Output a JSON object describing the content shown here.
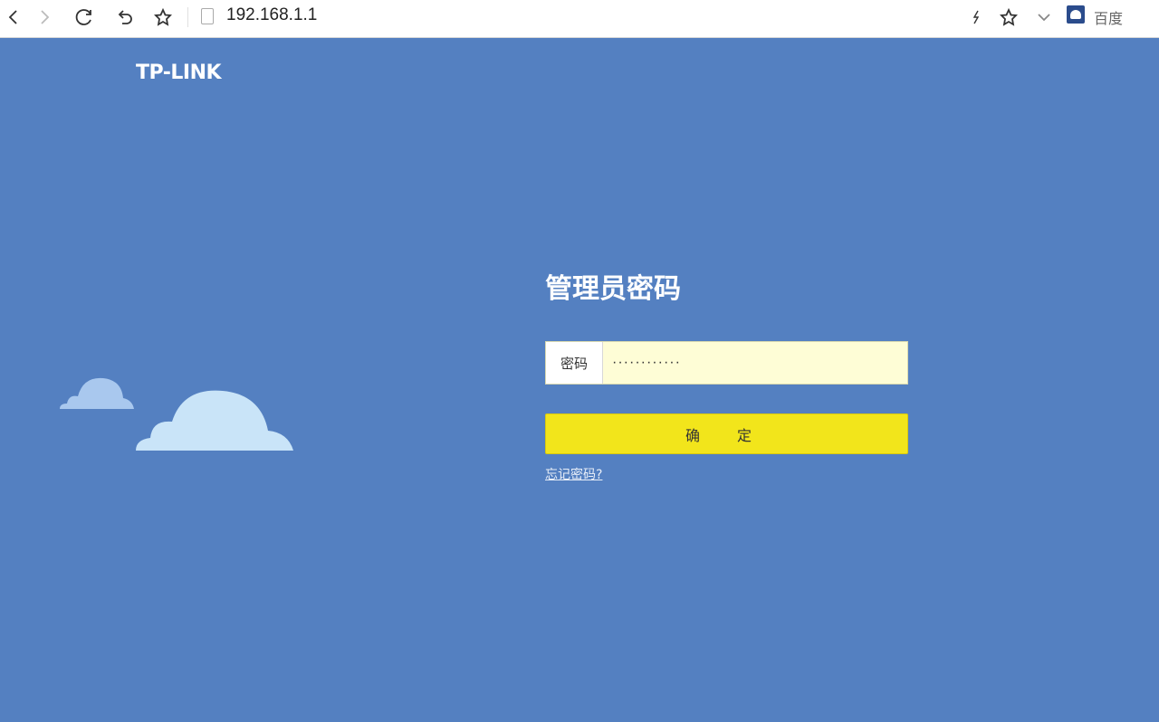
{
  "browser": {
    "url": "192.168.1.1",
    "search_engine": "百度"
  },
  "page": {
    "logo": "TP-LINK",
    "title": "管理员密码",
    "password_label": "密码",
    "password_value": "············",
    "confirm_label": "确 定",
    "forgot_link": "忘记密码?"
  },
  "colors": {
    "background": "#5480c1",
    "button": "#f2e51b",
    "input_bg": "#fefdd6",
    "cloud_small": "#a9c8ee",
    "cloud_large": "#c9e4f8"
  }
}
